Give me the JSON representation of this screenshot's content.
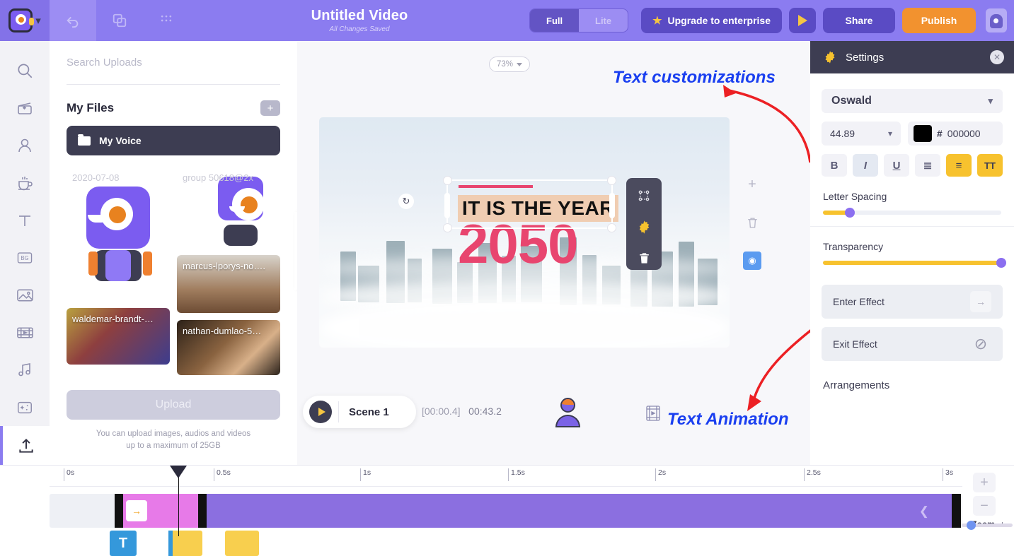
{
  "topbar": {
    "logo_icon": "robot-avatar-icon",
    "dropdown_icon": "chevron-down-icon",
    "undo_icon": "undo-icon",
    "copy_icon": "duplicate-icon",
    "grid_icon": "grid-icon",
    "title": "Untitled Video",
    "subtitle": "All Changes Saved",
    "mode_full": "Full",
    "mode_lite": "Lite",
    "upgrade_label": "Upgrade to enterprise",
    "upgrade_star": "★",
    "preview_icon": "play-icon",
    "share_label": "Share",
    "publish_label": "Publish",
    "profile_icon": "dog-avatar-icon"
  },
  "rail": {
    "items": [
      {
        "name": "search-icon"
      },
      {
        "name": "scenes-icon"
      },
      {
        "name": "characters-icon"
      },
      {
        "name": "props-icon"
      },
      {
        "name": "text-icon"
      },
      {
        "name": "background-icon"
      },
      {
        "name": "image-icon"
      },
      {
        "name": "video-icon"
      },
      {
        "name": "music-icon"
      },
      {
        "name": "effects-icon"
      }
    ],
    "upload_icon": "upload-icon",
    "bg_label": "BG"
  },
  "uploads": {
    "search_placeholder": "Search Uploads",
    "search_value": "",
    "my_files_label": "My Files",
    "add_folder_icon": "plus-icon",
    "folder_label": "My Voice",
    "files": [
      {
        "name": "2020-07-08"
      },
      {
        "name": "group 50618@2x"
      },
      {
        "name": "marcus-lporys-no…."
      },
      {
        "name": "waldemar-brandt-…"
      },
      {
        "name": "nathan-dumlao-5…"
      }
    ],
    "upload_button": "Upload",
    "hint_line1": "You can upload images, audios and videos",
    "hint_line2": "up to a maximum of 25GB",
    "collapse_icon": "chevron-left-icon"
  },
  "canvas": {
    "zoom_level": "73%",
    "zoom_caret": "chevron-down-icon",
    "text_line1": "IT IS THE YEAR",
    "text_line2": "2050",
    "rotate_icon": "rotate-icon",
    "ctx_items": [
      "reorder-icon",
      "settings-gear-icon",
      "delete-trash-icon"
    ],
    "tools": [
      "plus-icon",
      "trash-icon",
      "duplicate-icon"
    ],
    "scene_label": "Scene 1",
    "scene_play_icon": "play-icon",
    "time_current": "[00:00.4]",
    "time_total": "00:43.2",
    "character_icon": "character-avatar-icon",
    "film_icon": "film-strip-icon"
  },
  "annotations": {
    "text_customizations": "Text customizations",
    "text_animation": "Text Animation",
    "accent_color": "#1a3ff0",
    "box_color": "#ec2024"
  },
  "settings": {
    "title": "Settings",
    "gear_icon": "settings-gear-icon",
    "close_icon": "close-icon",
    "font_family": "Oswald",
    "font_dropdown_icon": "chevron-down-icon",
    "font_size": "44.89",
    "size_dropdown_icon": "chevron-down-icon",
    "color_hash": "#",
    "color_hex": "000000",
    "color_swatch": "#000000",
    "format_buttons": [
      {
        "label": "B",
        "name": "bold-button",
        "state": "off"
      },
      {
        "label": "I",
        "name": "italic-button",
        "state": "selected"
      },
      {
        "label": "U",
        "name": "underline-button",
        "state": "off"
      },
      {
        "label": "≣",
        "name": "list-button",
        "state": "off"
      },
      {
        "label": "≡",
        "name": "align-center-button",
        "state": "on"
      },
      {
        "label": "TT",
        "name": "uppercase-button",
        "state": "on"
      }
    ],
    "letter_spacing_label": "Letter Spacing",
    "letter_spacing_pct": 15,
    "transparency_label": "Transparency",
    "transparency_pct": 100,
    "enter_effect_label": "Enter Effect",
    "enter_effect_icon": "arrow-right-icon",
    "exit_effect_label": "Exit Effect",
    "exit_effect_icon": "no-effect-icon",
    "arrangements_label": "Arrangements"
  },
  "timeline": {
    "ticks": [
      "0s",
      "0.5s",
      "1s",
      "1.5s",
      "2s",
      "2.5s",
      "3s"
    ],
    "clip_icon": "transition-arrow-icon",
    "collapse_icon": "chevron-left-icon",
    "text_clip_label": "T",
    "zoom_in_icon": "plus-icon",
    "zoom_out_icon": "minus-icon",
    "zoom_label": "Zoom",
    "zoom_minus": "-",
    "zoom_plus": "+",
    "zoom_value": 12
  }
}
